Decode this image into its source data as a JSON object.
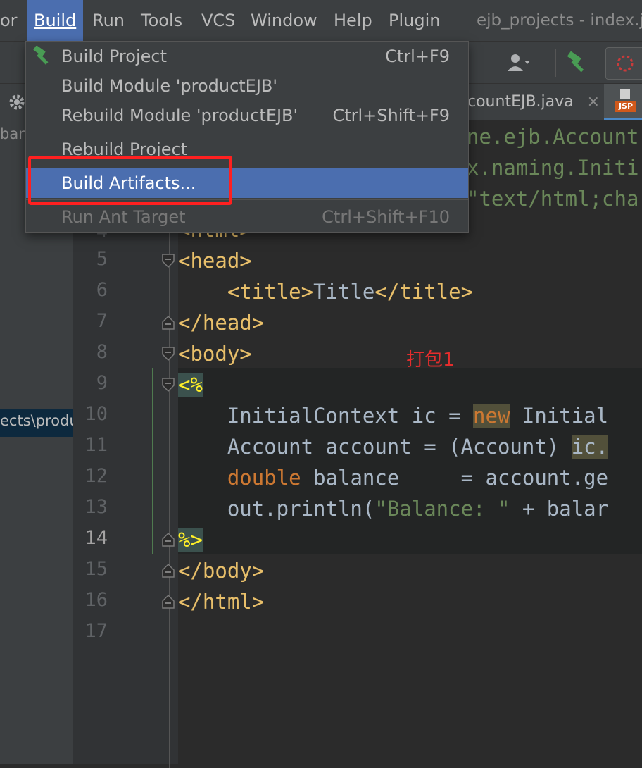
{
  "menubar": {
    "items": [
      "or",
      "Build",
      "Run",
      "Tools",
      "VCS",
      "Window",
      "Help",
      "Plugin"
    ],
    "window_title": "ejb_projects - index.j"
  },
  "tabs": {
    "editor_tab": "countEJB.java",
    "close_glyph": "×",
    "jsp_badge": "JSP"
  },
  "project_panel": {
    "fragment1": "ban",
    "fragment2": "ects\\produ"
  },
  "dropdown": {
    "items": [
      {
        "label": "Build Project",
        "shortcut": "Ctrl+F9",
        "icon": "hammer-icon"
      },
      {
        "label": "Build Module 'productEJB'",
        "shortcut": ""
      },
      {
        "label": "Rebuild Module 'productEJB'",
        "shortcut": "Ctrl+Shift+F9"
      },
      {
        "label": "Rebuild Project",
        "shortcut": ""
      },
      {
        "label": "Build Artifacts...",
        "shortcut": ""
      },
      {
        "label": "Run Ant Target",
        "shortcut": "Ctrl+Shift+F10"
      }
    ]
  },
  "editor": {
    "line_numbers": [
      "4",
      "5",
      "6",
      "7",
      "8",
      "9",
      "10",
      "11",
      "12",
      "13",
      "14",
      "15",
      "16",
      "17"
    ],
    "current_line": "14",
    "behind_menu": [
      "ne.ejb.Account",
      "x.naming.Initi",
      "\"text/html;cha"
    ]
  },
  "annotation": "打包1",
  "colors": {
    "accent": "#4b6eaf",
    "highlight_box": "#ff2020",
    "annotation": "#e52d2d"
  }
}
